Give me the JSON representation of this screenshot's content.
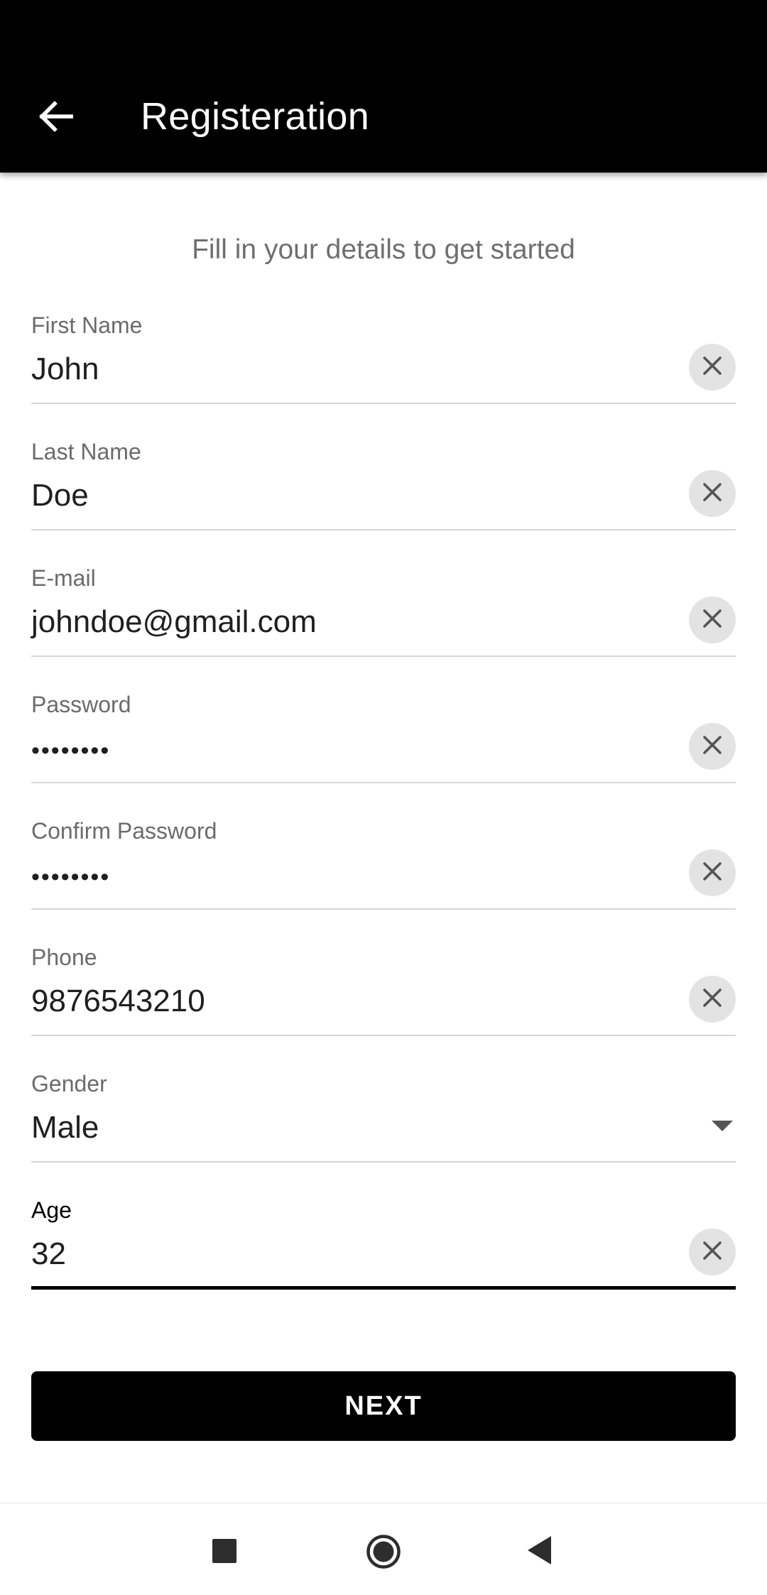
{
  "appbar": {
    "title": "Registeration",
    "back_icon": "arrow-left-icon"
  },
  "subtitle": "Fill in your details to get started",
  "fields": [
    {
      "label": "First Name",
      "value": "John",
      "type": "text",
      "clear_icon": "close-icon"
    },
    {
      "label": "Last Name",
      "value": "Doe",
      "type": "text",
      "clear_icon": "close-icon"
    },
    {
      "label": "E-mail",
      "value": "johndoe@gmail.com",
      "type": "email",
      "clear_icon": "close-icon"
    },
    {
      "label": "Password",
      "value": "••••••••",
      "type": "password",
      "clear_icon": "close-icon"
    },
    {
      "label": "Confirm Password",
      "value": "••••••••",
      "type": "password",
      "clear_icon": "close-icon"
    },
    {
      "label": "Phone",
      "value": "9876543210",
      "type": "tel",
      "clear_icon": "close-icon"
    },
    {
      "label": "Gender",
      "value": "Male",
      "type": "select",
      "dropdown_icon": "caret-down-icon"
    },
    {
      "label": "Age",
      "value": "32",
      "type": "number",
      "clear_icon": "close-icon",
      "focused": true
    }
  ],
  "next_button": {
    "label": "NEXT"
  },
  "navbar": {
    "recent_icon": "square-icon",
    "home_icon": "circle-icon",
    "back_icon": "triangle-back-icon"
  },
  "colors": {
    "appbar_bg": "#000000",
    "button_bg": "#000000",
    "label_color": "#6b6b6b",
    "underline": "#d6d6d6",
    "clear_bg": "#e3e3e3"
  }
}
